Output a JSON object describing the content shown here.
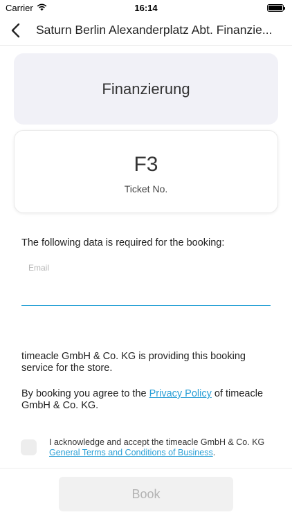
{
  "status_bar": {
    "carrier": "Carrier",
    "time": "16:14"
  },
  "nav": {
    "title": "Saturn Berlin Alexanderplatz Abt. Finanzie..."
  },
  "service": {
    "name": "Finanzierung"
  },
  "ticket": {
    "number": "F3",
    "label": "Ticket No."
  },
  "form": {
    "intro": "The following data is required for the booking:",
    "email_label": "Email",
    "email_value": ""
  },
  "legal": {
    "provider_text": "timeacle GmbH & Co. KG is providing this booking service for the store.",
    "agree_prefix": "By booking you agree to the ",
    "privacy_link": "Privacy Policy",
    "agree_suffix": " of timeacle GmbH & Co. KG.",
    "terms_text": "I acknowledge and accept the timeacle GmbH & Co. KG ",
    "terms_link": "General Terms and Conditions of Business",
    "terms_suffix": "."
  },
  "actions": {
    "book_label": "Book"
  },
  "colors": {
    "accent": "#2a9fd6",
    "header_card_bg": "#f1f1f7",
    "button_disabled_bg": "#f1f1f1"
  }
}
